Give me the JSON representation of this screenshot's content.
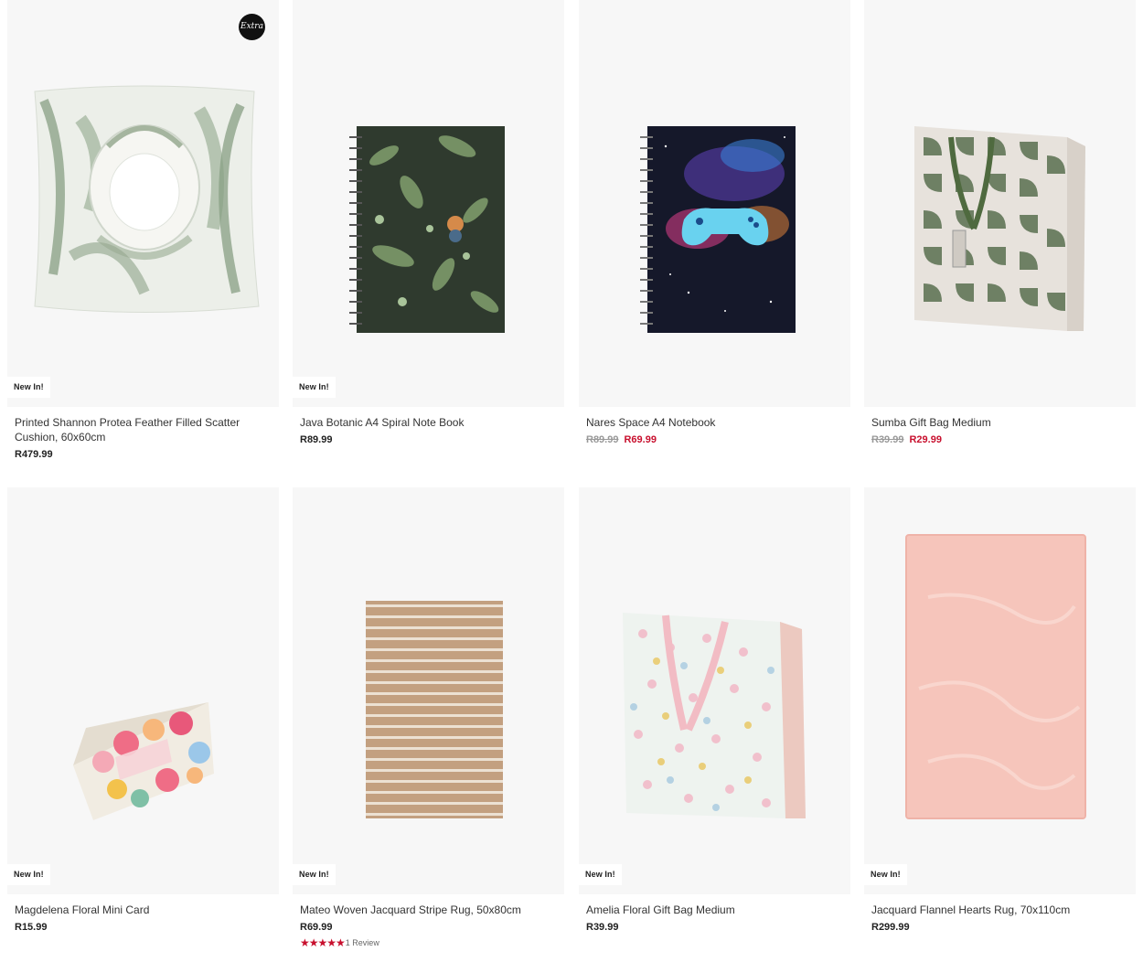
{
  "products": [
    {
      "name": "Printed Shannon Protea Feather Filled Scatter Cushion, 60x60cm",
      "price": "R479.99",
      "badge": "New In!",
      "extra_badge": "Extra"
    },
    {
      "name": "Java Botanic A4 Spiral Note Book",
      "price": "R89.99",
      "badge": "New In!"
    },
    {
      "name": "Nares Space A4 Notebook",
      "old_price": "R89.99",
      "sale_price": "R69.99"
    },
    {
      "name": "Sumba Gift Bag Medium",
      "old_price": "R39.99",
      "sale_price": "R29.99"
    },
    {
      "name": "Magdelena Floral Mini Card",
      "price": "R15.99",
      "badge": "New In!"
    },
    {
      "name": "Mateo Woven Jacquard Stripe Rug, 50x80cm",
      "price": "R69.99",
      "badge": "New In!",
      "stars": "★★★★★",
      "reviews": "1 Review"
    },
    {
      "name": "Amelia Floral Gift Bag Medium",
      "price": "R39.99",
      "badge": "New In!"
    },
    {
      "name": "Jacquard Flannel Hearts Rug, 70x110cm",
      "price": "R299.99",
      "badge": "New In!"
    }
  ],
  "colors": {
    "sale": "#c8102e",
    "card_bg": "#f7f7f7",
    "text": "#333333"
  }
}
